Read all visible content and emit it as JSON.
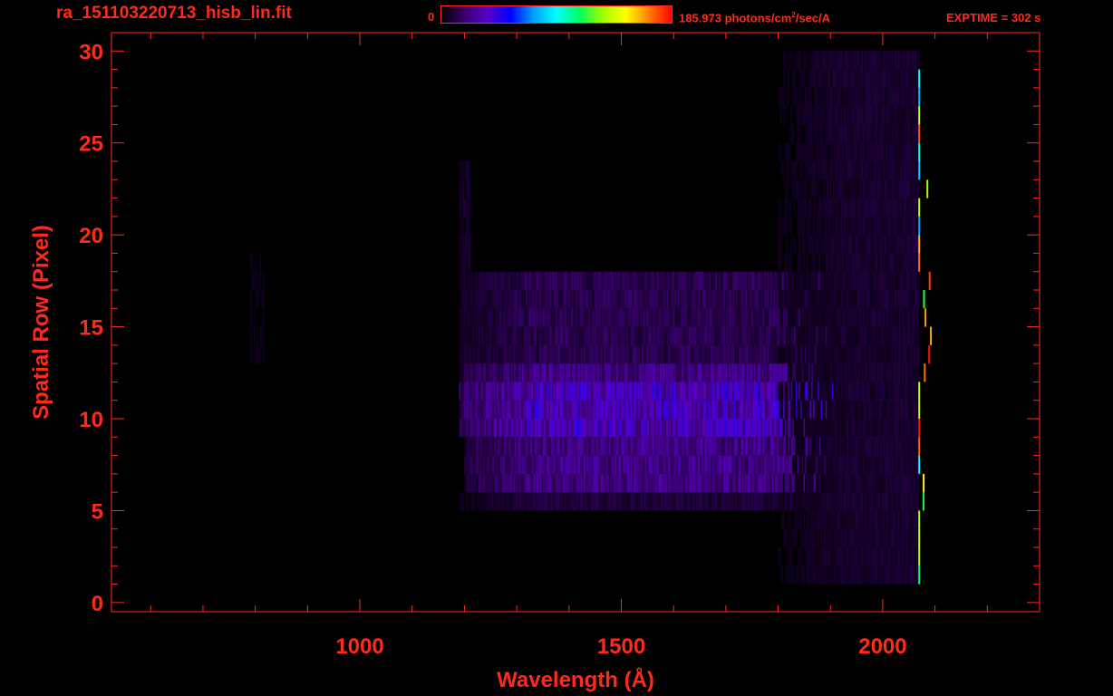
{
  "header": {
    "filename": "ra_151103220713_hisb_lin.fit",
    "colorbar_min": "0",
    "colorbar_max_value": "185.973 photons/cm",
    "colorbar_max_sup": "2",
    "colorbar_max_tail": "/sec/A",
    "exptime": "EXPTIME = 302 s"
  },
  "colors": {
    "axis": "#ff2a1a",
    "background": "#000000",
    "colormap": [
      "#000000",
      "#3a0070",
      "#5a00c8",
      "#0000ff",
      "#00a0ff",
      "#00ffff",
      "#00ff60",
      "#a0ff00",
      "#ffff00",
      "#ff8000",
      "#ff0000"
    ]
  },
  "chart_data": {
    "type": "heatmap",
    "xlabel": "Wavelength (Å)",
    "ylabel": "Spatial Row (Pixel)",
    "xlim": [
      525,
      2300
    ],
    "ylim": [
      -0.5,
      31
    ],
    "x_ticks": [
      1000,
      1500,
      2000
    ],
    "y_ticks": [
      0,
      5,
      10,
      15,
      20,
      25,
      30
    ],
    "x_minor_step": 100,
    "y_minor_step": 1,
    "colorbar_range": [
      0,
      185.973
    ],
    "bands": [
      {
        "wmin": 1190,
        "wmax": 2060,
        "rmin": 9,
        "rmax": 12,
        "level": 0.18,
        "peak_w": 1980,
        "peak_level": 0.45
      },
      {
        "wmin": 1190,
        "wmax": 2060,
        "rmin": 12,
        "rmax": 13,
        "level": 0.12
      },
      {
        "wmin": 1200,
        "wmax": 2060,
        "rmin": 6,
        "rmax": 9,
        "level": 0.12
      },
      {
        "wmin": 1200,
        "wmax": 2060,
        "rmin": 13,
        "rmax": 18,
        "level": 0.07
      },
      {
        "wmin": 1190,
        "wmax": 2060,
        "rmin": 5,
        "rmax": 6,
        "level": 0.05
      },
      {
        "wmin": 1190,
        "wmax": 1210,
        "rmin": 13,
        "rmax": 24,
        "level": 0.07
      },
      {
        "wmin": 790,
        "wmax": 815,
        "rmin": 13,
        "rmax": 19,
        "level": 0.04
      },
      {
        "wmin": 1800,
        "wmax": 2070,
        "rmin": 1,
        "rmax": 30,
        "level": 0.04
      }
    ],
    "edge_line": {
      "wavelength": 2068,
      "rmin": 1,
      "rmax": 29
    }
  }
}
